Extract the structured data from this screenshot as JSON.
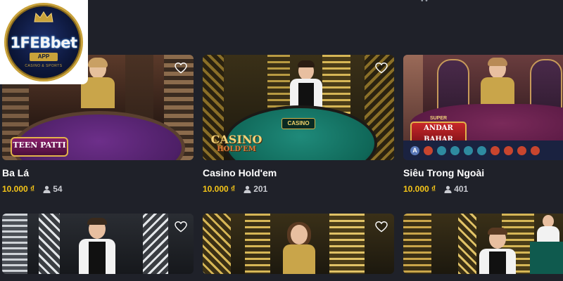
{
  "brand": {
    "name": "1FEBbet",
    "tag": "APP",
    "sub": "CASINO & SPORTS"
  },
  "cards": [
    {
      "title": "Ba Lá",
      "price": "10.000 ₫",
      "players": "54",
      "logo": "TEEN PATTI"
    },
    {
      "title": "Casino Hold'em",
      "price": "10.000 ₫",
      "players": "201",
      "logo_line1": "CASINO",
      "logo_line2": "HOLD'EM",
      "table_logo": "CASINO"
    },
    {
      "title": "Siêu Trong Ngoài",
      "price": "10.000 ₫",
      "players": "401",
      "logo_top": "SUPER",
      "logo": "ANDAR BAHAR",
      "bead_letter": "A"
    },
    {
      "title": "",
      "price": "",
      "players": ""
    },
    {
      "title": "",
      "price": "",
      "players": ""
    },
    {
      "title": "",
      "price": "",
      "players": ""
    }
  ],
  "colors": {
    "background": "#1f2129",
    "price": "#f5c518",
    "players": "#c9cbd1"
  }
}
